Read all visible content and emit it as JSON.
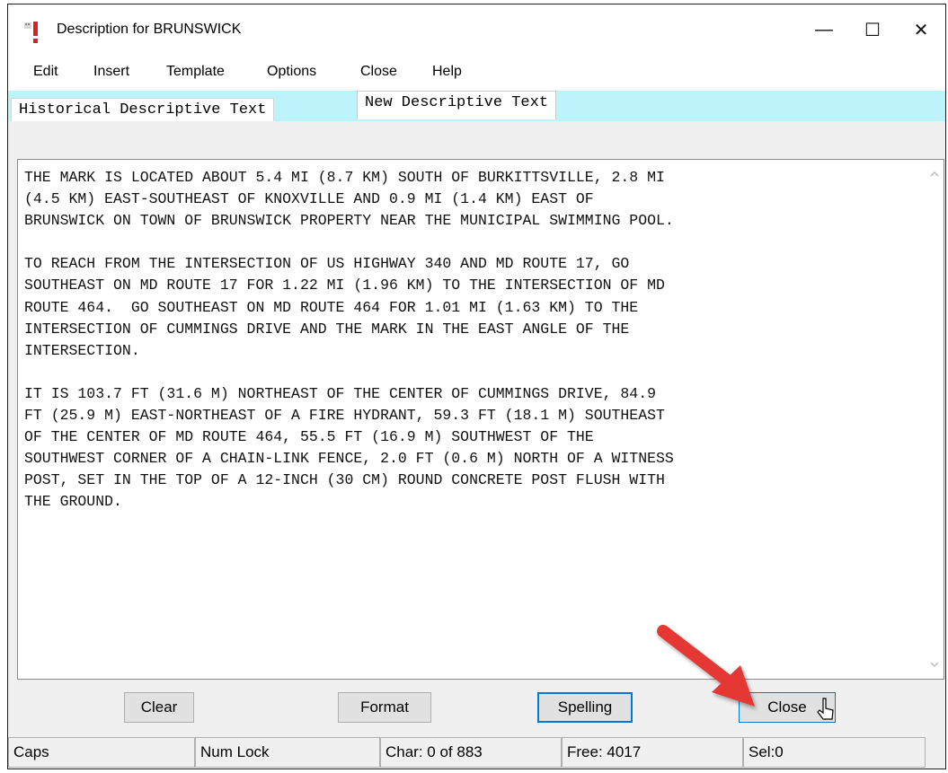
{
  "window": {
    "title": "Description for BRUNSWICK",
    "controls": {
      "minimize": "—",
      "maximize": "☐",
      "close": "✕"
    }
  },
  "menu": [
    "Edit",
    "Insert",
    "Template",
    "Options",
    "Close",
    "Help"
  ],
  "tabs": {
    "historical": "Historical Descriptive Text",
    "new": "New Descriptive Text"
  },
  "description_text": "THE MARK IS LOCATED ABOUT 5.4 MI (8.7 KM) SOUTH OF BURKITTSVILLE, 2.8 MI\n(4.5 KM) EAST-SOUTHEAST OF KNOXVILLE AND 0.9 MI (1.4 KM) EAST OF\nBRUNSWICK ON TOWN OF BRUNSWICK PROPERTY NEAR THE MUNICIPAL SWIMMING POOL.\n\nTO REACH FROM THE INTERSECTION OF US HIGHWAY 340 AND MD ROUTE 17, GO\nSOUTHEAST ON MD ROUTE 17 FOR 1.22 MI (1.96 KM) TO THE INTERSECTION OF MD\nROUTE 464.  GO SOUTHEAST ON MD ROUTE 464 FOR 1.01 MI (1.63 KM) TO THE\nINTERSECTION OF CUMMINGS DRIVE AND THE MARK IN THE EAST ANGLE OF THE\nINTERSECTION.\n\nIT IS 103.7 FT (31.6 M) NORTHEAST OF THE CENTER OF CUMMINGS DRIVE, 84.9\nFT (25.9 M) EAST-NORTHEAST OF A FIRE HYDRANT, 59.3 FT (18.1 M) SOUTHEAST\nOF THE CENTER OF MD ROUTE 464, 55.5 FT (16.9 M) SOUTHWEST OF THE\nSOUTHWEST CORNER OF A CHAIN-LINK FENCE, 2.0 FT (0.6 M) NORTH OF A WITNESS\nPOST, SET IN THE TOP OF A 12-INCH (30 CM) ROUND CONCRETE POST FLUSH WITH\nTHE GROUND.",
  "buttons": {
    "clear": "Clear",
    "format": "Format",
    "spelling": "Spelling",
    "close": "Close"
  },
  "status": {
    "caps": "Caps",
    "num_lock": "Num Lock",
    "char": "Char: 0 of 883",
    "free": "Free: 4017",
    "sel": "Sel:0"
  },
  "colors": {
    "tab_strip": "#bdf4fb",
    "focus_border": "#0078d7",
    "annotation_arrow": "#e53935",
    "app_icon_red": "#e02020"
  },
  "icons": {
    "app": "exclamation-doc-icon",
    "scroll_up": "chevron-up-icon",
    "scroll_down": "chevron-down-icon",
    "annotation": "red-arrow-annotation",
    "cursor": "mouse-pointer-icon"
  }
}
